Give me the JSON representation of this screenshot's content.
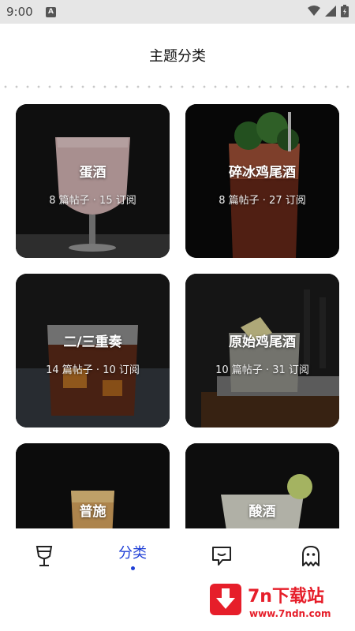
{
  "status_bar": {
    "time": "9:00",
    "notification_badge": "A"
  },
  "header": {
    "title": "主题分类"
  },
  "categories": [
    {
      "title": "蛋酒",
      "meta": "8 篇帖子 · 15 订阅"
    },
    {
      "title": "碎冰鸡尾酒",
      "meta": "8 篇帖子 · 27 订阅"
    },
    {
      "title": "二/三重奏",
      "meta": "14 篇帖子 · 10 订阅"
    },
    {
      "title": "原始鸡尾酒",
      "meta": "10 篇帖子 · 31 订阅"
    },
    {
      "title": "普施",
      "meta": ""
    },
    {
      "title": "酸酒",
      "meta": ""
    }
  ],
  "bottom_nav": {
    "items": [
      {
        "icon": "glass-icon",
        "label": ""
      },
      {
        "icon": "",
        "label": "分类",
        "active": true
      },
      {
        "icon": "chat-bubble-icon",
        "label": ""
      },
      {
        "icon": "ghost-icon",
        "label": ""
      }
    ]
  },
  "watermark": {
    "title": "7n下载站",
    "url": "www.7ndn.com"
  },
  "colors": {
    "accent": "#1f3fd6",
    "watermark_red": "#e61e2a"
  }
}
